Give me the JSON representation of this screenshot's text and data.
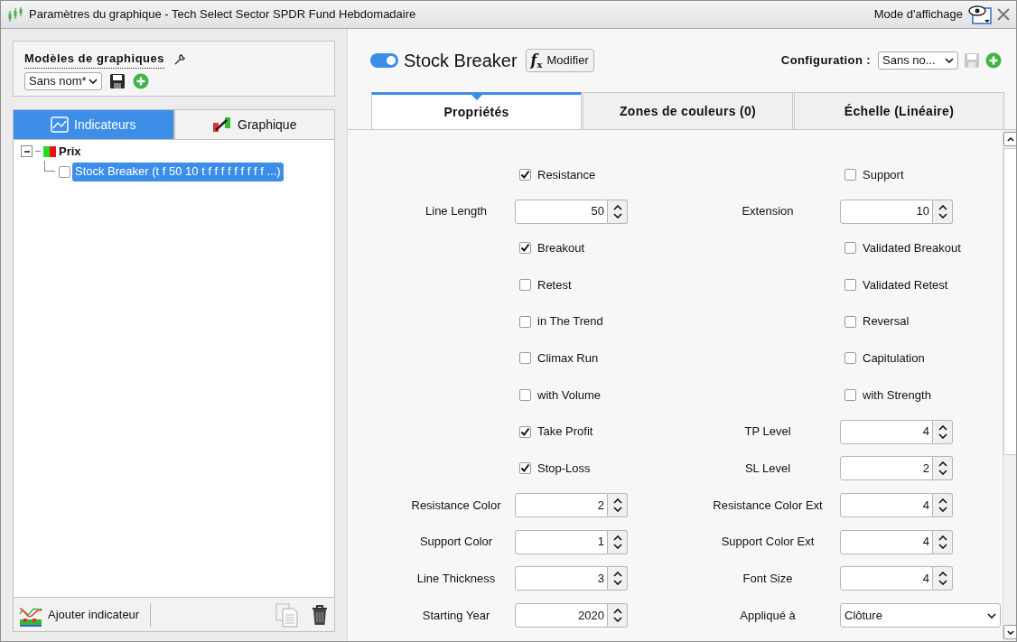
{
  "window": {
    "title": "Paramètres du graphique - Tech Select Sector SPDR Fund Hebdomadaire",
    "view_mode": "Mode d'affichage"
  },
  "templates": {
    "title": "Modèles de graphiques",
    "select": "Sans nom*"
  },
  "left_tabs": [
    {
      "label": "Indicateurs",
      "selected": true
    },
    {
      "label": "Graphique",
      "selected": false
    }
  ],
  "tree": [
    {
      "label": "Prix",
      "expanded": true,
      "children": [
        {
          "label": "Stock Breaker (t f 50 10 t f f f f f f f f f ...)",
          "checked": false,
          "selected": true
        }
      ]
    }
  ],
  "left_footer": {
    "add": "Ajouter indicateur"
  },
  "indicator": {
    "name": "Stock Breaker",
    "on": true,
    "modify": "Modifier",
    "fx": "f",
    "fx_sub": "x"
  },
  "configuration": {
    "label": "Configuration :",
    "select": "Sans no..."
  },
  "tabs": [
    {
      "label": "Propriétés",
      "selected": true
    },
    {
      "label": "Zones de couleurs (0)",
      "selected": false
    },
    {
      "label": "Échelle (Linéaire)",
      "selected": false
    }
  ],
  "rows": [
    [
      {
        "kind": "checkbox",
        "label": "Resistance",
        "checked": true
      },
      {
        "kind": "checkbox",
        "label": "Support",
        "checked": false
      }
    ],
    [
      {
        "kind": "number",
        "label": "Line Length",
        "value": "50"
      },
      {
        "kind": "number",
        "label": "Extension",
        "value": "10"
      }
    ],
    [
      {
        "kind": "checkbox",
        "label": "Breakout",
        "checked": true
      },
      {
        "kind": "checkbox",
        "label": "Validated Breakout",
        "checked": false
      }
    ],
    [
      {
        "kind": "checkbox",
        "label": "Retest",
        "checked": false
      },
      {
        "kind": "checkbox",
        "label": "Validated Retest",
        "checked": false
      }
    ],
    [
      {
        "kind": "checkbox",
        "label": "in The Trend",
        "checked": false
      },
      {
        "kind": "checkbox",
        "label": "Reversal",
        "checked": false
      }
    ],
    [
      {
        "kind": "checkbox",
        "label": "Climax Run",
        "checked": false
      },
      {
        "kind": "checkbox",
        "label": "Capitulation",
        "checked": false
      }
    ],
    [
      {
        "kind": "checkbox",
        "label": "with Volume",
        "checked": false
      },
      {
        "kind": "checkbox",
        "label": "with Strength",
        "checked": false
      }
    ],
    [
      {
        "kind": "checkbox",
        "label": "Take Profit",
        "checked": true
      },
      {
        "kind": "number",
        "label": "TP Level",
        "value": "4"
      }
    ],
    [
      {
        "kind": "checkbox",
        "label": "Stop-Loss",
        "checked": true
      },
      {
        "kind": "number",
        "label": "SL Level",
        "value": "2"
      }
    ],
    [
      {
        "kind": "number",
        "label": "Resistance Color",
        "value": "2"
      },
      {
        "kind": "number",
        "label": "Resistance Color Ext",
        "value": "4"
      }
    ],
    [
      {
        "kind": "number",
        "label": "Support Color",
        "value": "1"
      },
      {
        "kind": "number",
        "label": "Support Color Ext",
        "value": "4"
      }
    ],
    [
      {
        "kind": "number",
        "label": "Line Thickness",
        "value": "3"
      },
      {
        "kind": "number",
        "label": "Font Size",
        "value": "4"
      }
    ],
    [
      {
        "kind": "number",
        "label": "Starting Year",
        "value": "2020"
      },
      {
        "kind": "select",
        "label": "Appliqué à",
        "value": "Clôture"
      }
    ]
  ]
}
